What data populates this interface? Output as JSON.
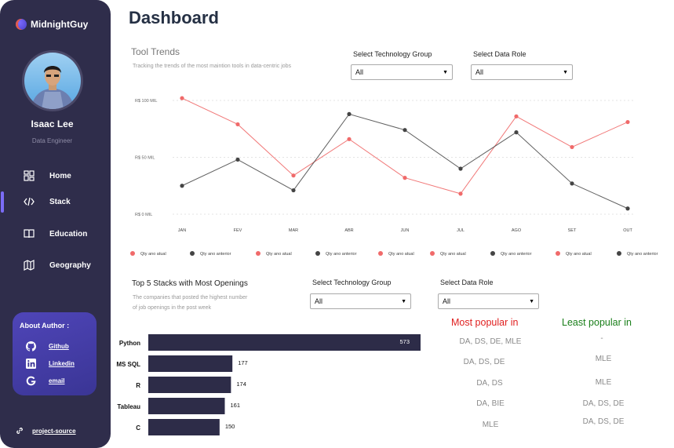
{
  "brand": {
    "name": "MidnightGuy"
  },
  "user": {
    "name": "Isaac Lee",
    "role": "Data Engineer"
  },
  "nav": [
    {
      "label": "Home",
      "icon": "grid-icon"
    },
    {
      "label": "Stack",
      "icon": "code-icon"
    },
    {
      "label": "Education",
      "icon": "book-open-icon"
    },
    {
      "label": "Geography",
      "icon": "map-icon"
    }
  ],
  "active_nav": "Stack",
  "about": {
    "title": "About Author :",
    "links": [
      {
        "label": "Github",
        "icon": "github-icon"
      },
      {
        "label": "Linkedin",
        "icon": "linkedin-icon"
      },
      {
        "label": "email",
        "icon": "google-icon"
      }
    ]
  },
  "project_link": "project-source",
  "page_title": "Dashboard",
  "trends": {
    "title": "Tool Trends",
    "subtitle": "Tracking the trends of the most maintion tools in data-centric jobs",
    "filter1_label": "Select Technology Group",
    "filter1_value": "All",
    "filter2_label": "Select Data Role",
    "filter2_value": "All"
  },
  "stacks": {
    "title": "Top 5 Stacks with Most Openings",
    "subtitle_line1": "The companies that posted the highest number",
    "subtitle_line2": "of job openings in the post week",
    "filter1_label": "Select Technology Group",
    "filter1_value": "All",
    "filter2_label": "Select Data Role",
    "filter2_value": "All"
  },
  "popularity": {
    "most_header": "Most popular in",
    "least_header": "Least popular in",
    "most": [
      "DA, DS, DE, MLE",
      "DA, DS, DE",
      "DA, DS",
      "DA, BIE",
      "MLE"
    ],
    "least": [
      "-",
      "MLE",
      "MLE",
      "DA, DS, DE",
      "DA, DS, DE"
    ]
  },
  "colors": {
    "sidebar": "#2f2d4b",
    "accent": "#7b6cf6",
    "current": "#f06a6a",
    "previous": "#444444",
    "bar": "#2d2c48",
    "most": "#e02020",
    "least": "#1a7f1a"
  },
  "chart_data": [
    {
      "type": "line",
      "categories": [
        "JAN",
        "FEV",
        "MAR",
        "ABR",
        "JUN",
        "JUL",
        "AGO",
        "SET",
        "OUT"
      ],
      "y_tick_labels": [
        "R$ 0 MIL",
        "R$ 50 MIL",
        "R$ 100 MIL"
      ],
      "ylim": [
        0,
        100
      ],
      "grid": true,
      "series": [
        {
          "name": "Qty ano atual",
          "color": "#f06a6a",
          "values": [
            102,
            79,
            34,
            66,
            32,
            18,
            86,
            59,
            81
          ]
        },
        {
          "name": "Qty ano anterior",
          "color": "#444444",
          "values": [
            25,
            48,
            21,
            88,
            74,
            40,
            72,
            27,
            5
          ]
        }
      ],
      "legend": [
        "Qty ano atual",
        "Qty ano anterior",
        "Qty ano atual",
        "Qty ano anterior",
        "Qty ano atual",
        "Qty ano atual",
        "Qty ano anterior",
        "Qty ano atual",
        "Qty ano anterior"
      ],
      "legend_colors": [
        "#f06a6a",
        "#444444",
        "#f06a6a",
        "#444444",
        "#f06a6a",
        "#f06a6a",
        "#444444",
        "#f06a6a",
        "#444444"
      ]
    },
    {
      "type": "bar",
      "orientation": "horizontal",
      "categories": [
        "Python",
        "MS SQL",
        "R",
        "Tableau",
        "C"
      ],
      "values": [
        573,
        177,
        174,
        161,
        150
      ],
      "xlim": [
        0,
        573
      ]
    }
  ]
}
